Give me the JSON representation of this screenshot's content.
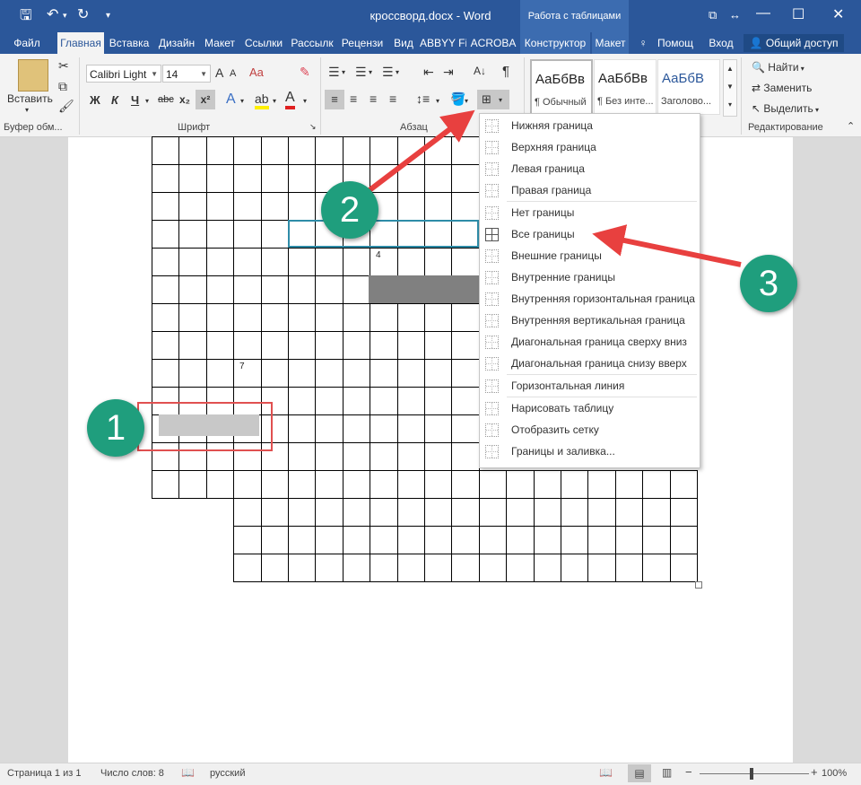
{
  "titlebar": {
    "doc_title": "кроссворд.docx - Word",
    "context_tab": "Работа с таблицами"
  },
  "tabs": [
    "Файл",
    "Главная",
    "Вставка",
    "Дизайн",
    "Макет",
    "Ссылки",
    "Рассылк",
    "Рецензи",
    "Вид",
    "ABBYY Fi",
    "ACROBA",
    "Конструктор",
    "Макет",
    "Помощ",
    "Вход"
  ],
  "share_label": "Общий доступ",
  "ribbon": {
    "paste_label": "Вставить",
    "clipboard_group": "Буфер обм...",
    "font_name": "Calibri Light",
    "font_size": "14",
    "font_group": "Шрифт",
    "paragraph_group": "Абзац",
    "bold": "Ж",
    "italic": "К",
    "underline": "Ч",
    "strike": "abc",
    "subscript": "x₂",
    "superscript": "x²",
    "grow_font": "A",
    "shrink_font": "A",
    "sort_glyph": "А↓",
    "pilcrow": "¶",
    "styles": [
      {
        "sample": "АаБбВв",
        "name": "¶ Обычный"
      },
      {
        "sample": "АаБбВв",
        "name": "¶ Без инте..."
      },
      {
        "sample": "АаБбВ",
        "name": "Заголово..."
      }
    ],
    "find_label": "Найти",
    "replace_label": "Заменить",
    "select_label": "Выделить",
    "editing_group": "Редактирование"
  },
  "crossword_numbers": [
    "4",
    "7"
  ],
  "border_menu": [
    {
      "label": "Нижняя граница",
      "icon": "bottom-border-icon"
    },
    {
      "label": "Верхняя граница",
      "icon": "top-border-icon"
    },
    {
      "label": "Левая граница",
      "icon": "left-border-icon"
    },
    {
      "label": "Правая граница",
      "icon": "right-border-icon"
    },
    {
      "label": "Нет границы",
      "icon": "no-border-icon"
    },
    {
      "label": "Все границы",
      "icon": "all-borders-icon"
    },
    {
      "label": "Внешние границы",
      "icon": "outside-borders-icon"
    },
    {
      "label": "Внутренние границы",
      "icon": "inside-borders-icon"
    },
    {
      "label": "Внутренняя горизонтальная граница",
      "icon": "inside-horizontal-border-icon"
    },
    {
      "label": "Внутренняя вертикальная граница",
      "icon": "inside-vertical-border-icon"
    },
    {
      "label": "Диагональная граница сверху вниз",
      "icon": "diagonal-down-border-icon"
    },
    {
      "label": "Диагональная граница снизу вверх",
      "icon": "diagonal-up-border-icon"
    },
    {
      "label": "Горизонтальная линия",
      "icon": "horizontal-line-icon"
    },
    {
      "label": "Нарисовать таблицу",
      "icon": "draw-table-icon"
    },
    {
      "label": "Отобразить сетку",
      "icon": "view-gridlines-icon"
    },
    {
      "label": "Границы и заливка...",
      "icon": "borders-shading-icon"
    }
  ],
  "status": {
    "page": "Страница 1 из 1",
    "words": "Число слов: 8",
    "language": "русский",
    "zoom": "100%"
  },
  "callouts": [
    "1",
    "2",
    "3"
  ],
  "colors": {
    "word_blue": "#2b579a",
    "callout_green": "#1f9e7d",
    "arrow_red": "#e8403f",
    "selection_gray": "#c8c8c8",
    "dark_cell": "#808080",
    "teal_border": "#2e8ca8"
  }
}
